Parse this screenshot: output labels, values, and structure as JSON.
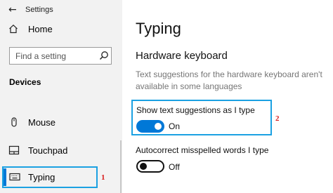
{
  "app": {
    "title": "Settings"
  },
  "sidebar": {
    "home_label": "Home",
    "search_placeholder": "Find a setting",
    "section_label": "Devices",
    "items": [
      {
        "label": "Mouse",
        "icon": "mouse-icon"
      },
      {
        "label": "Touchpad",
        "icon": "touchpad-icon"
      },
      {
        "label": "Typing",
        "icon": "keyboard-icon",
        "selected": true
      }
    ]
  },
  "main": {
    "title": "Typing",
    "subheading": "Hardware keyboard",
    "description": "Text suggestions for the hardware keyboard aren't available in some languages",
    "settings": [
      {
        "label": "Show text suggestions as I type",
        "state": "On",
        "enabled": true
      },
      {
        "label": "Autocorrect misspelled words I type",
        "state": "Off",
        "enabled": false
      }
    ]
  },
  "annotations": {
    "callout_1": "1",
    "callout_2": "2"
  },
  "colors": {
    "accent": "#0078d7",
    "highlight_border": "#1ba1e2",
    "callout_text": "#d81b1b",
    "sidebar_bg": "#f2f2f2"
  }
}
